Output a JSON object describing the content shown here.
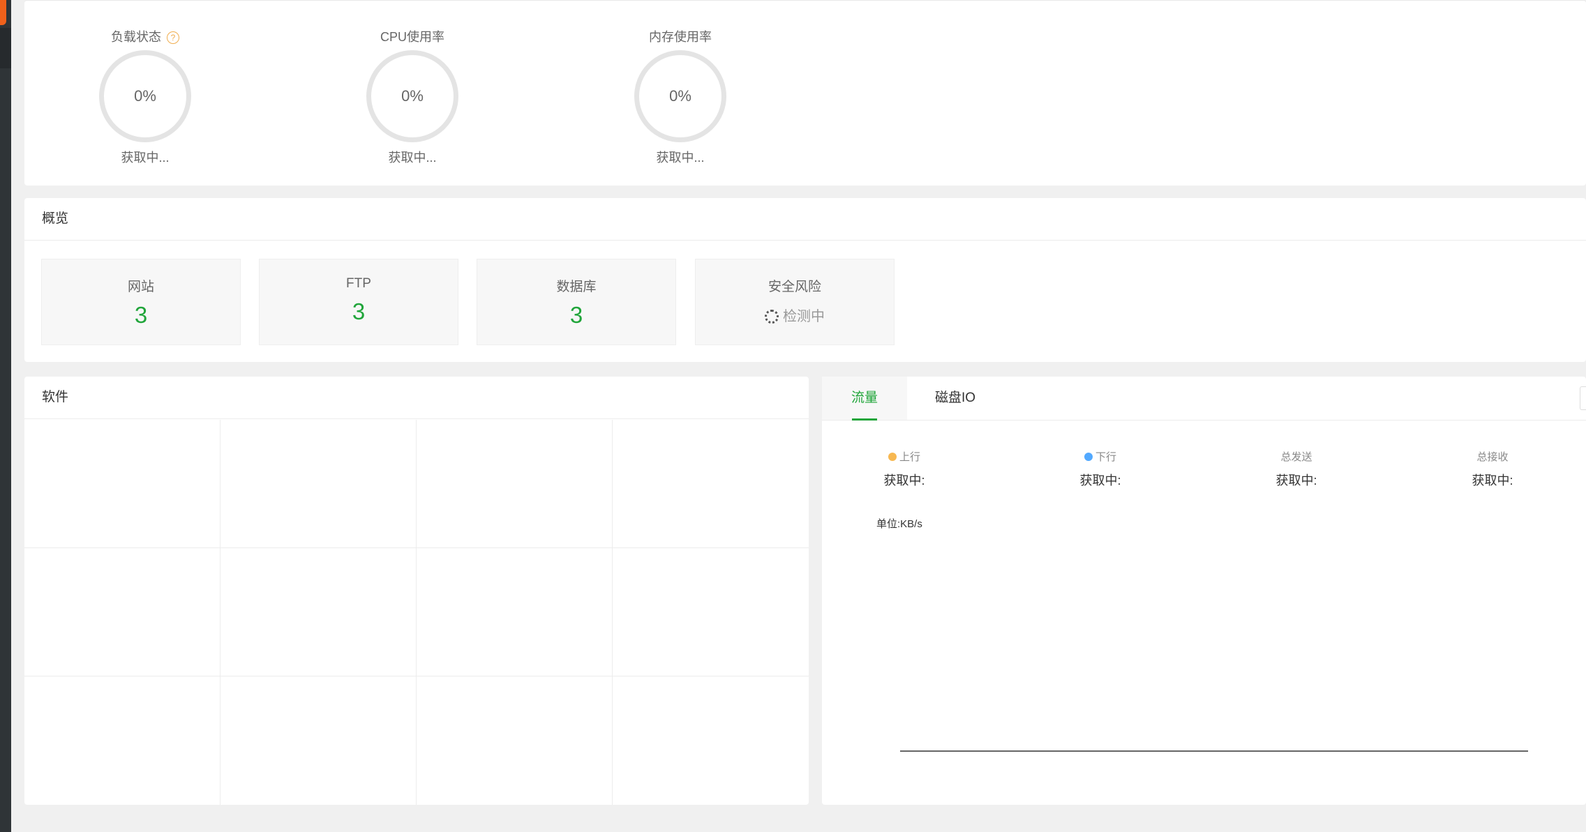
{
  "status": {
    "gauges": [
      {
        "title": "负载状态",
        "value": "0%",
        "sub": "获取中..."
      },
      {
        "title": "CPU使用率",
        "value": "0%",
        "sub": "获取中..."
      },
      {
        "title": "内存使用率",
        "value": "0%",
        "sub": "获取中..."
      }
    ],
    "help_symbol": "?"
  },
  "overview": {
    "title": "概览",
    "cards": [
      {
        "label": "网站",
        "value": "3"
      },
      {
        "label": "FTP",
        "value": "3"
      },
      {
        "label": "数据库",
        "value": "3"
      },
      {
        "label": "安全风险",
        "status": "检测中"
      }
    ]
  },
  "software": {
    "title": "软件"
  },
  "traffic": {
    "tabs": [
      {
        "label": "流量"
      },
      {
        "label": "磁盘IO"
      }
    ],
    "stats": [
      {
        "label": "上行",
        "value": "获取中:",
        "color": "#f7b851"
      },
      {
        "label": "下行",
        "value": "获取中:",
        "color": "#52a9ff"
      },
      {
        "label": "总发送",
        "value": "获取中:"
      },
      {
        "label": "总接收",
        "value": "获取中:"
      }
    ],
    "unit": "单位:KB/s"
  },
  "colors": {
    "accent": "#20a53a",
    "sidebar": "#2f3437",
    "brand": "#f0611b"
  }
}
